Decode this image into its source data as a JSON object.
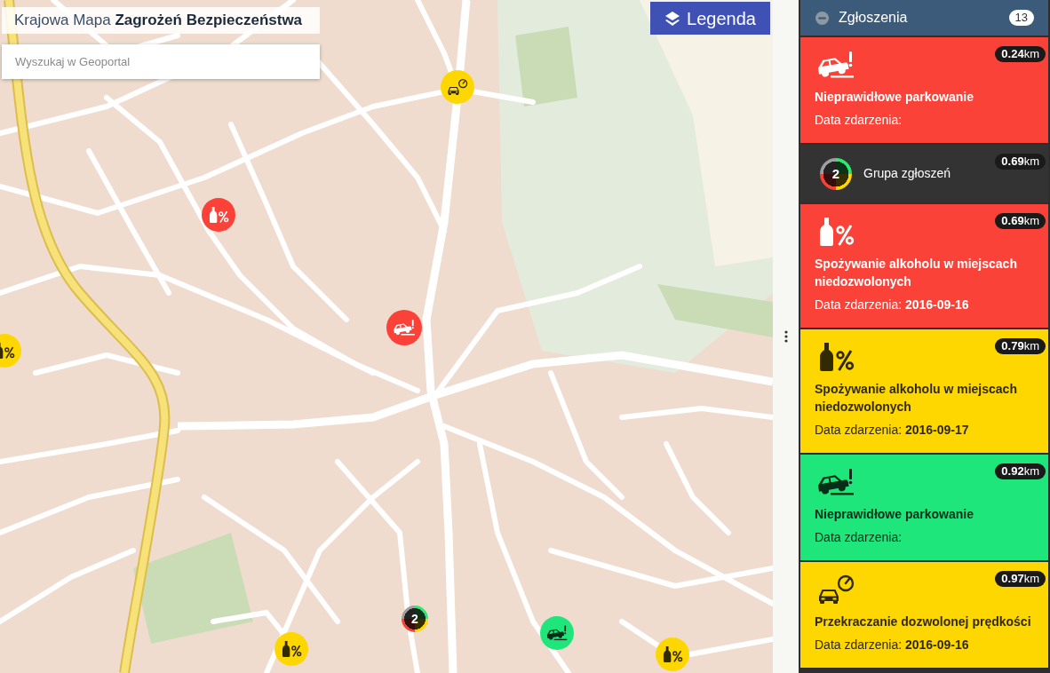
{
  "map": {
    "title": "Krajowa Mapa **Zagrożeń Bezpieczeństwa**",
    "search": {
      "placeholder": "Wyszukaj w Geoportal"
    },
    "legend_button": "Legenda",
    "markers": [
      {
        "kind": "speeding",
        "color": "#ffd700"
      },
      {
        "kind": "alcohol",
        "color": "#fa4238"
      },
      {
        "kind": "parking",
        "color": "#fa4238"
      },
      {
        "kind": "alcohol",
        "color": "#ffd700"
      },
      {
        "kind": "group",
        "count": "2"
      },
      {
        "kind": "parking",
        "color": "#1ee67a"
      },
      {
        "kind": "alcohol",
        "color": "#ffd700"
      },
      {
        "kind": "alcohol",
        "color": "#ffd700"
      }
    ]
  },
  "panel": {
    "title": "Zgłoszenia",
    "count": "13",
    "expanded": true,
    "reports": [
      {
        "kind": "parking",
        "color": "#fa4238",
        "distance": "**0.24**km",
        "title": "Nieprawidłowe parkowanie",
        "date": "Data zdarzenia:"
      },
      {
        "kind": "group",
        "count": "2",
        "distance": "**0.69**km",
        "title": "Grupa zgłoszeń"
      },
      {
        "kind": "alcohol",
        "color": "#fa4238",
        "distance": "**0.69**km",
        "title": "Spożywanie alkoholu w miejscach niedozwolonych",
        "date": "Data zdarzenia: **2016-09-16**"
      },
      {
        "kind": "alcohol",
        "color": "#ffd700",
        "distance": "**0.79**km",
        "title": "Spożywanie alkoholu w miejscach niedozwolonych",
        "date": "Data zdarzenia: **2016-09-17**"
      },
      {
        "kind": "parking",
        "color": "#1ee67a",
        "distance": "**0.92**km",
        "title": "Nieprawidłowe parkowanie",
        "date": "Data zdarzenia:"
      },
      {
        "kind": "speeding",
        "color": "#ffd700",
        "distance": "**0.97**km",
        "title": "Przekraczanie dozwolonej prędkości",
        "date": "Data zdarzenia: **2016-09-16**"
      }
    ]
  }
}
